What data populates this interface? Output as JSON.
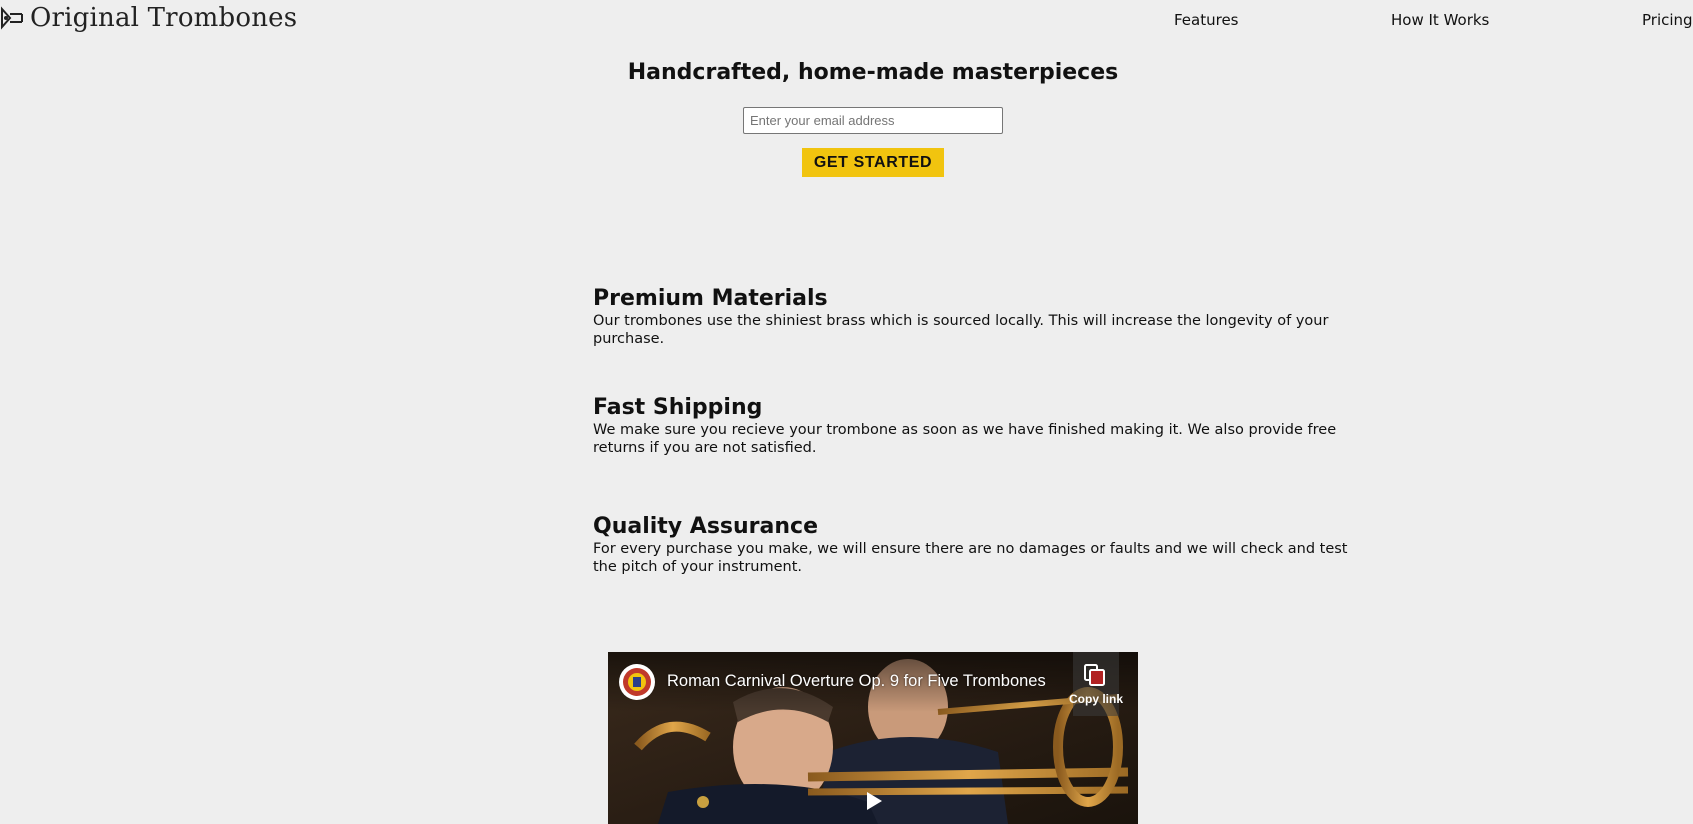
{
  "header": {
    "logo_text": "Original Trombones",
    "logo_icon": "trombone-icon",
    "nav": [
      {
        "label": "Features"
      },
      {
        "label": "How It Works"
      },
      {
        "label": "Pricing"
      }
    ]
  },
  "hero": {
    "title": "Handcrafted, home-made masterpieces",
    "email_placeholder": "Enter your email address",
    "email_value": "",
    "cta_label": "GET STARTED",
    "cta_color": "#f1c40f"
  },
  "features": [
    {
      "title": "Premium Materials",
      "text": "Our trombones use the shiniest brass which is sourced locally. This will increase the longevity of your purchase."
    },
    {
      "title": "Fast Shipping",
      "text": "We make sure you recieve your trombone as soon as we have finished making it. We also provide free returns if you are not satisfied."
    },
    {
      "title": "Quality Assurance",
      "text": "For every purchase you make, we will ensure there are no damages or faults and we will check and test the pitch of your instrument."
    }
  ],
  "video": {
    "title": "Roman Carnival Overture Op. 9 for Five Trombones",
    "copy_link_label": "Copy link",
    "copy_icon": "copy-icon",
    "play_icon": "play-icon",
    "channel_icon": "channel-avatar"
  }
}
